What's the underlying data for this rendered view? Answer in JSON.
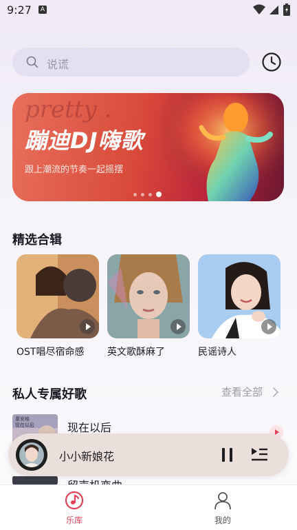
{
  "status_bar": {
    "time": "9:27",
    "notification_badge": "A"
  },
  "search": {
    "placeholder": "说谎"
  },
  "banner": {
    "decoration": "pretty .",
    "title": "蹦迪DJ嗨歌",
    "subtitle": "跟上潮流的节奏一起摇摆",
    "dots": 4,
    "active_dot": 4
  },
  "featured": {
    "title": "精选合辑",
    "playlists": [
      {
        "title": "OST唱尽宿命感"
      },
      {
        "title": "英文歌酥麻了"
      },
      {
        "title": "民谣诗人"
      }
    ]
  },
  "private_songs": {
    "title": "私人专属好歌",
    "see_all": "查看全部",
    "songs": [
      {
        "title": "现在以后",
        "thumb_text": "童安格\n现在以后"
      },
      {
        "title": "留声机恋曲"
      }
    ]
  },
  "mini_player": {
    "title": "小小新娘花"
  },
  "nav": {
    "items": [
      {
        "label": "乐库",
        "active": true
      },
      {
        "label": "我的",
        "active": false
      }
    ]
  },
  "colors": {
    "accent": "#e0405a",
    "inactive": "#555555"
  }
}
